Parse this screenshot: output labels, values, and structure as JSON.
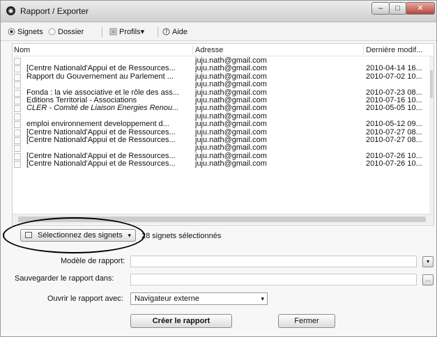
{
  "window": {
    "title": "Rapport / Exporter",
    "controls": {
      "minimize": "–",
      "maximize": "□",
      "close": "✕"
    }
  },
  "toolbar": {
    "signets": "Signets",
    "dossier": "Dossier",
    "profils": "Profils",
    "aide": "Aide"
  },
  "list": {
    "columns": {
      "nom": "Nom",
      "adresse": "Adresse",
      "date": "Dernière modif..."
    },
    "rows": [
      {
        "nom": "",
        "adresse": "juju.nath@gmail.com",
        "date": ""
      },
      {
        "nom": "[Centre Nationald'Appui et de Ressources...",
        "adresse": "juju.nath@gmail.com",
        "date": "2010-04-14 16..."
      },
      {
        "nom": "Rapport du Gouvernement au Parlement ...",
        "adresse": "juju.nath@gmail.com",
        "date": "2010-07-02 10..."
      },
      {
        "nom": "",
        "adresse": "juju.nath@gmail.com",
        "date": ""
      },
      {
        "nom": "Fonda : la vie associative et le rôle des ass...",
        "adresse": "juju.nath@gmail.com",
        "date": "2010-07-23 08..."
      },
      {
        "nom": "Editions Territorial - Associations",
        "adresse": "juju.nath@gmail.com",
        "date": "2010-07-16 10..."
      },
      {
        "nom": "CLER - Comité de Liaison Energies Renou...",
        "adresse": "juju.nath@gmail.com",
        "date": "2010-05-05 10...",
        "italic": true
      },
      {
        "nom": "",
        "adresse": "juju.nath@gmail.com",
        "date": ""
      },
      {
        "nom": "emploi environnement developpement d...",
        "adresse": "juju.nath@gmail.com",
        "date": "2010-05-12 09..."
      },
      {
        "nom": "[Centre Nationald'Appui et de Ressources...",
        "adresse": "juju.nath@gmail.com",
        "date": "2010-07-27 08..."
      },
      {
        "nom": "[Centre Nationald'Appui et de Ressources...",
        "adresse": "juju.nath@gmail.com",
        "date": "2010-07-27 08..."
      },
      {
        "nom": "",
        "adresse": "juju.nath@gmail.com",
        "date": ""
      },
      {
        "nom": "[Centre Nationald'Appui et de Ressources...",
        "adresse": "juju.nath@gmail.com",
        "date": "2010-07-26 10..."
      },
      {
        "nom": "[Centre Nationald'Appui et de Ressources...",
        "adresse": "juju.nath@gmail.com",
        "date": "2010-07-26 10..."
      }
    ]
  },
  "selection": {
    "button_label": "Sélectionnez des signets",
    "count_text": "28 signets sélectionnés"
  },
  "form": {
    "modele_label": "Modèle de rapport:",
    "modele_value": "",
    "sauver_label": "Sauvegarder le rapport dans:",
    "sauver_value": "",
    "ouvrir_label": "Ouvrir le rapport avec:",
    "ouvrir_value": "Navigateur externe"
  },
  "buttons": {
    "create": "Créer le rapport",
    "close": "Fermer"
  }
}
